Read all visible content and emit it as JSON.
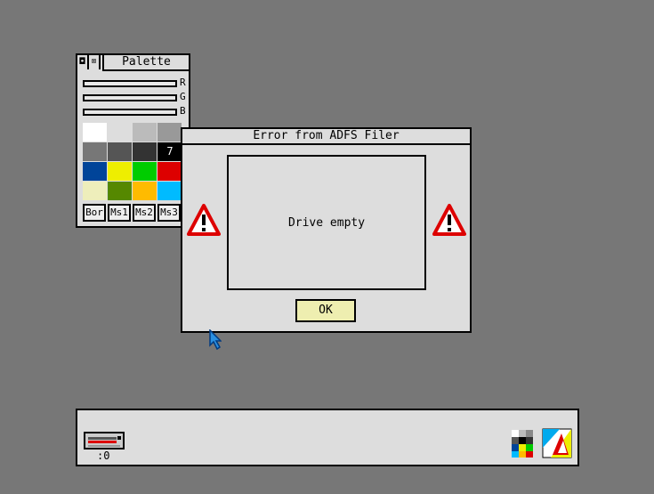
{
  "palette_window": {
    "title": "Palette",
    "channels": [
      "R",
      "G",
      "B"
    ],
    "swatches": [
      "#ffffff",
      "#dddddd",
      "#bbbbbb",
      "#999999",
      "#777777",
      "#555555",
      "#333333",
      "#000000",
      "#004499",
      "#eeee00",
      "#00cc00",
      "#dd0000",
      "#eeeebb",
      "#558800",
      "#ffbb00",
      "#00bbff"
    ],
    "selected_number": "7",
    "buttons": [
      "Bor",
      "Ms1",
      "Ms2",
      "Ms3"
    ]
  },
  "error_dialog": {
    "title": "Error from ADFS Filer",
    "message": "Drive empty",
    "ok_label": "OK"
  },
  "iconbar": {
    "drive_label": ":0",
    "icons": [
      "floppy-drive-icon",
      "palette-app-icon",
      "acorn-app-icon"
    ]
  },
  "colors": {
    "desktop": "#777777",
    "window_bg": "#dddddd",
    "warning_red": "#dd0000",
    "ok_button": "#eeeeb0"
  }
}
